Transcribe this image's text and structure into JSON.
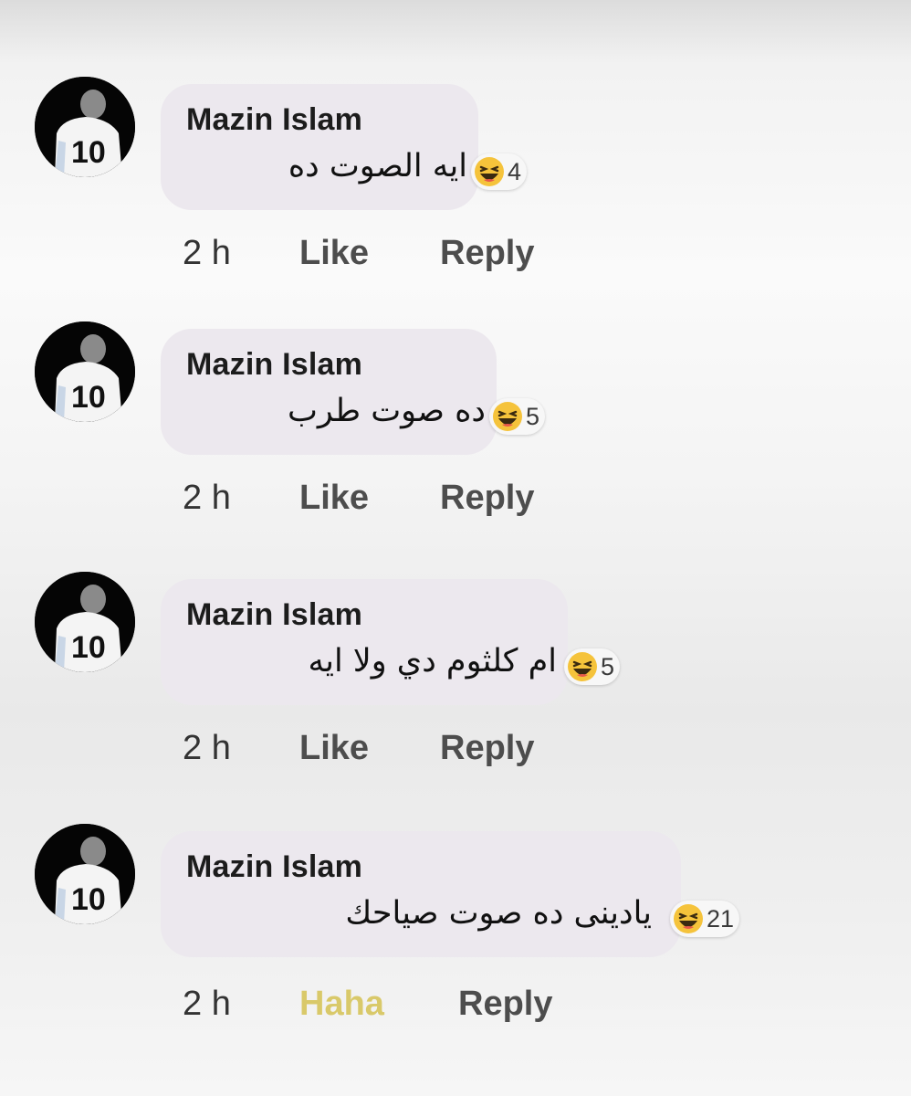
{
  "comments": [
    {
      "author": "Mazin Islam",
      "text": "ايه الصوت ده",
      "reaction_count": "4",
      "time": "2 h",
      "like_label": "Like",
      "reply_label": "Reply",
      "jersey_number": "10"
    },
    {
      "author": "Mazin Islam",
      "text": "ده صوت طرب",
      "reaction_count": "5",
      "time": "2 h",
      "like_label": "Like",
      "reply_label": "Reply",
      "jersey_number": "10"
    },
    {
      "author": "Mazin Islam",
      "text": "ام كلثوم دي ولا ايه",
      "reaction_count": "5",
      "time": "2 h",
      "like_label": "Like",
      "reply_label": "Reply",
      "jersey_number": "10"
    },
    {
      "author": "Mazin Islam",
      "text": "يادينى ده صوت صياحك",
      "reaction_count": "21",
      "time": "2 h",
      "like_label": "Haha",
      "reply_label": "Reply",
      "jersey_number": "10"
    }
  ],
  "colors": {
    "bubble": "#ece8ee",
    "haha_active": "#d9c96a",
    "action_text": "#4d4d4d"
  },
  "icons": {
    "avatar": "player-jersey-10",
    "reaction": "haha-emoji-icon"
  }
}
